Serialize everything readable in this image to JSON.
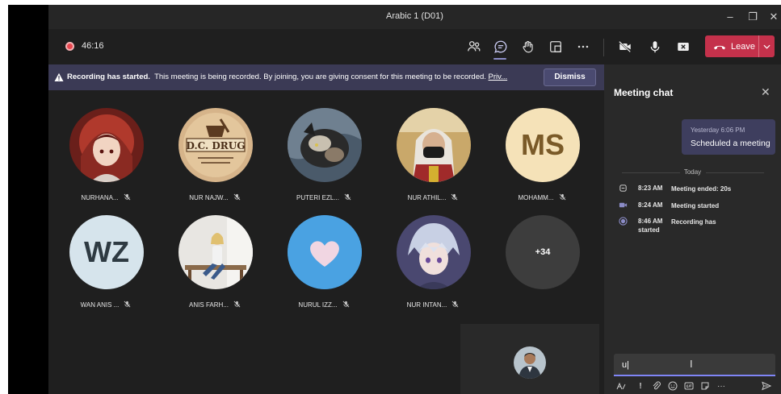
{
  "window": {
    "title": "Arabic 1 (D01)",
    "minimize": "–",
    "restore": "❐",
    "close": "✕"
  },
  "toolbar": {
    "timer": "46:16",
    "leave_label": "Leave",
    "accent": "#c4314b"
  },
  "banner": {
    "bold": "Recording has started.",
    "text": "This meeting is being recorded. By joining, you are giving consent for this meeting to be recorded.",
    "link": "Priv...",
    "dismiss_label": "Dismiss"
  },
  "participants": [
    {
      "name": "NURHANA...",
      "avatar": "anime-girl-red-hood"
    },
    {
      "name": "NUR NAJW...",
      "avatar": "dc-drug-logo"
    },
    {
      "name": "PUTERI EZL...",
      "avatar": "cat-photo"
    },
    {
      "name": "NUR ATHIL...",
      "avatar": "hijab-mask-photo"
    },
    {
      "name": "MOHAMM...",
      "initials": "MS"
    },
    {
      "name": "WAN ANIS ...",
      "initials": "WZ"
    },
    {
      "name": "ANIS FARH...",
      "avatar": "woman-bench-photo"
    },
    {
      "name": "NURUL IZZ...",
      "avatar": "heart-cloud-sky"
    },
    {
      "name": "NUR INTAN...",
      "avatar": "anime-boy-silver-hair"
    }
  ],
  "avatar_texts": {
    "dc_drug": "D.C. DRUG"
  },
  "more_count": "+34",
  "chat": {
    "title": "Meeting chat",
    "message": {
      "time": "Yesterday 6:06 PM",
      "text": "Scheduled a meeting"
    },
    "divider": "Today",
    "events": [
      {
        "time": "8:23 AM",
        "text": "Meeting ended: 20s",
        "icon": "call-end-icon"
      },
      {
        "time": "8:24 AM",
        "text": "Meeting started",
        "icon": "video-icon"
      },
      {
        "time": "8:46 AM",
        "text": "Recording has",
        "text2": "started",
        "icon": "record-icon"
      }
    ],
    "input_value": "u|",
    "input_cursor": "I",
    "more_label": "···"
  }
}
